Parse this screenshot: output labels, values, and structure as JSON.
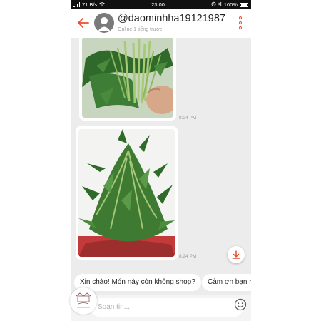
{
  "status_bar": {
    "speed": "71 B/s",
    "time": "23:00",
    "battery": "100%"
  },
  "header": {
    "username": "@daominhha19121987",
    "status": "Online 1 tiếng trước",
    "back_icon": "arrow-left-icon",
    "menu_icon": "more-vertical-icon"
  },
  "messages": [
    {
      "type": "image",
      "alt": "photo of green vegetable bunch held in hand",
      "time": "8:24 PM"
    },
    {
      "type": "image",
      "alt": "photo of leafy green vegetables on table",
      "time": "8:24 PM"
    }
  ],
  "quick_replies": [
    "Xin chào! Món này còn không shop?",
    "Cảm ơn bạn r"
  ],
  "input": {
    "placeholder": "Soạn tin..."
  },
  "colors": {
    "accent": "#ee4d2d",
    "chat_bg": "#ececec"
  }
}
